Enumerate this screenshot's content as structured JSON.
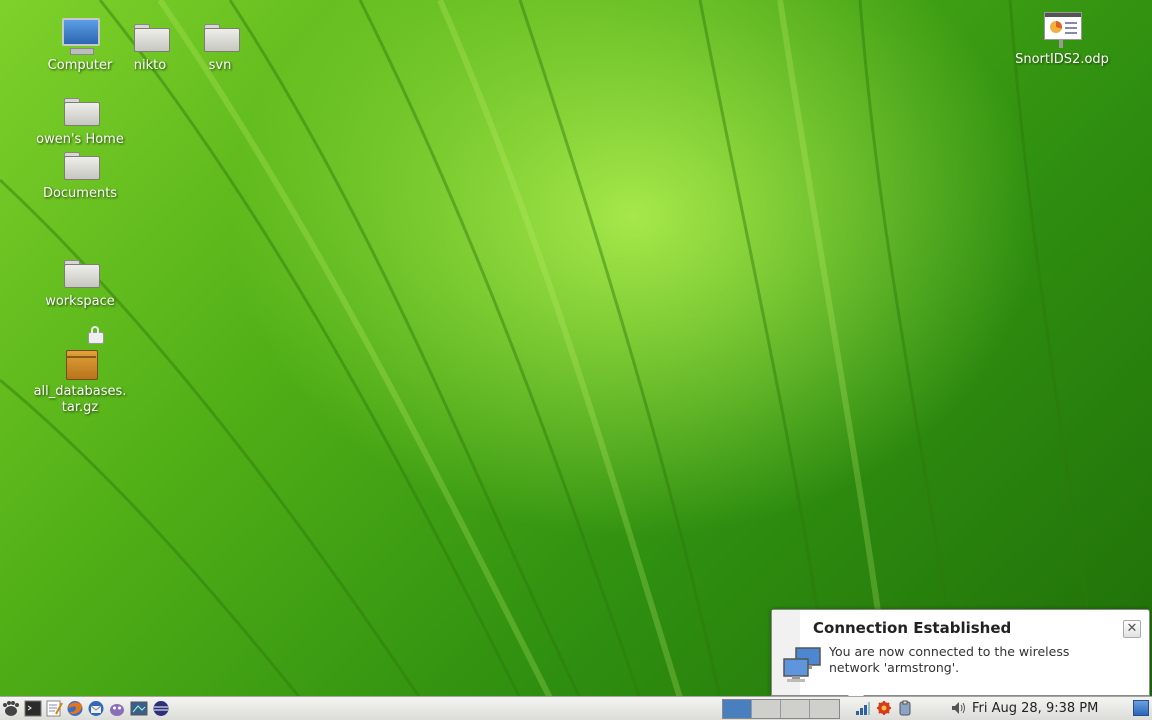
{
  "desktop": {
    "icons": {
      "computer": "Computer",
      "nikto": "nikto",
      "svn": "svn",
      "home": "owen's Home",
      "documents": "Documents",
      "workspace": "workspace",
      "archive_line1": "all_databases.",
      "archive_line2": "tar.gz",
      "presentation": "SnortIDS2.odp"
    }
  },
  "notification": {
    "title": "Connection Established",
    "body": "You are now connected to the wireless network 'armstrong'.",
    "icon": "network-computers-icon",
    "close_icon": "close-icon"
  },
  "taskbar": {
    "launchers": [
      "menu-foot-icon",
      "terminal-icon",
      "text-editor-icon",
      "firefox-icon",
      "thunderbird-icon",
      "pidgin-icon",
      "screenshot-icon",
      "eclipse-icon"
    ],
    "workspaces": 4,
    "active_workspace": 1,
    "tray": [
      "network-signal-icon",
      "update-notifier-icon",
      "clipboard-icon",
      "volume-icon"
    ],
    "clock": "Fri Aug 28,  9:38 PM"
  },
  "colors": {
    "wallpaper": "#5cb81c",
    "active_workspace": "#4a7fbf"
  }
}
